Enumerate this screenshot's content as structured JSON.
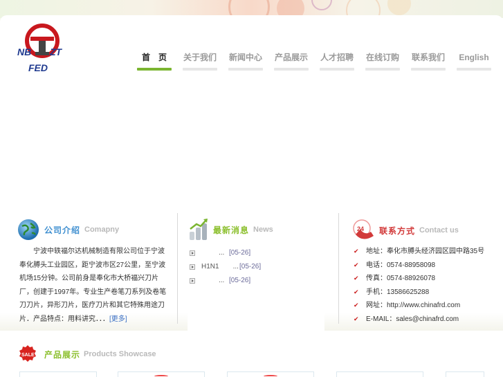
{
  "logo": {
    "line1": "NB",
    "line1b": "ZT",
    "line2": "FED"
  },
  "nav": {
    "items": [
      {
        "label": "首　页",
        "active": true
      },
      {
        "label": "关于我们"
      },
      {
        "label": "新闻中心"
      },
      {
        "label": "产品展示"
      },
      {
        "label": "人才招聘"
      },
      {
        "label": "在线订购"
      },
      {
        "label": "联系我们"
      },
      {
        "label": "English"
      }
    ]
  },
  "company": {
    "title_cn": "公司介绍",
    "title_en": "Comapny",
    "text": "　　宁波中轶福尔达机械制造有限公司位于宁波奉化膊头工业园区，距宁波市区27公里，至宁波机场15分钟。公司前身是奉化市大桥福兴刀片厂，创建于1997年。专业生产卷笔刀系列及卷笔刀刀片，异形刀片，医疗刀片和其它特殊用途刀片．产品特点：用料讲究．．．",
    "more": "[更多]"
  },
  "news": {
    "title_cn": "最新消息",
    "title_en": "News",
    "items": [
      {
        "title": "...",
        "date": "[05-26]"
      },
      {
        "title": "H1N1　　...",
        "date": "[05-26]"
      },
      {
        "title": "...",
        "date": "[05-26]"
      }
    ]
  },
  "contact": {
    "title_cn": "联系方式",
    "title_en": "Contact us",
    "badge": "24",
    "items": [
      "地址：奉化市膊头经济园区园中路35号",
      "电话：0574-88958098",
      "传真：0574-88926078",
      "手机：13586625288",
      "网址：http://www.chinafrd.com",
      "E-MAIL：sales@chinafrd.com"
    ]
  },
  "showcase": {
    "badge": "SALE",
    "title_cn": "产品展示",
    "title_en": "Products Showcase"
  },
  "colors": {
    "accent_green": "#7bb531",
    "title_blue": "#3f8fd0",
    "title_green": "#8bbf2c",
    "title_red": "#d23a3a"
  }
}
